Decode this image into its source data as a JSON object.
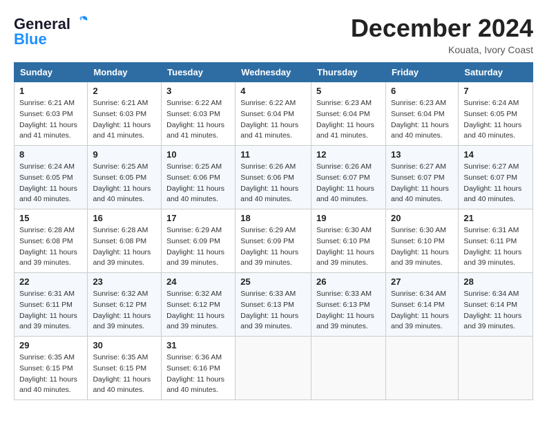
{
  "header": {
    "logo_line1": "General",
    "logo_line2": "Blue",
    "month_title": "December 2024",
    "location": "Kouata, Ivory Coast"
  },
  "days_of_week": [
    "Sunday",
    "Monday",
    "Tuesday",
    "Wednesday",
    "Thursday",
    "Friday",
    "Saturday"
  ],
  "weeks": [
    [
      {
        "day": "1",
        "sunrise": "6:21 AM",
        "sunset": "6:03 PM",
        "daylight": "11 hours and 41 minutes."
      },
      {
        "day": "2",
        "sunrise": "6:21 AM",
        "sunset": "6:03 PM",
        "daylight": "11 hours and 41 minutes."
      },
      {
        "day": "3",
        "sunrise": "6:22 AM",
        "sunset": "6:03 PM",
        "daylight": "11 hours and 41 minutes."
      },
      {
        "day": "4",
        "sunrise": "6:22 AM",
        "sunset": "6:04 PM",
        "daylight": "11 hours and 41 minutes."
      },
      {
        "day": "5",
        "sunrise": "6:23 AM",
        "sunset": "6:04 PM",
        "daylight": "11 hours and 41 minutes."
      },
      {
        "day": "6",
        "sunrise": "6:23 AM",
        "sunset": "6:04 PM",
        "daylight": "11 hours and 40 minutes."
      },
      {
        "day": "7",
        "sunrise": "6:24 AM",
        "sunset": "6:05 PM",
        "daylight": "11 hours and 40 minutes."
      }
    ],
    [
      {
        "day": "8",
        "sunrise": "6:24 AM",
        "sunset": "6:05 PM",
        "daylight": "11 hours and 40 minutes."
      },
      {
        "day": "9",
        "sunrise": "6:25 AM",
        "sunset": "6:05 PM",
        "daylight": "11 hours and 40 minutes."
      },
      {
        "day": "10",
        "sunrise": "6:25 AM",
        "sunset": "6:06 PM",
        "daylight": "11 hours and 40 minutes."
      },
      {
        "day": "11",
        "sunrise": "6:26 AM",
        "sunset": "6:06 PM",
        "daylight": "11 hours and 40 minutes."
      },
      {
        "day": "12",
        "sunrise": "6:26 AM",
        "sunset": "6:07 PM",
        "daylight": "11 hours and 40 minutes."
      },
      {
        "day": "13",
        "sunrise": "6:27 AM",
        "sunset": "6:07 PM",
        "daylight": "11 hours and 40 minutes."
      },
      {
        "day": "14",
        "sunrise": "6:27 AM",
        "sunset": "6:07 PM",
        "daylight": "11 hours and 40 minutes."
      }
    ],
    [
      {
        "day": "15",
        "sunrise": "6:28 AM",
        "sunset": "6:08 PM",
        "daylight": "11 hours and 39 minutes."
      },
      {
        "day": "16",
        "sunrise": "6:28 AM",
        "sunset": "6:08 PM",
        "daylight": "11 hours and 39 minutes."
      },
      {
        "day": "17",
        "sunrise": "6:29 AM",
        "sunset": "6:09 PM",
        "daylight": "11 hours and 39 minutes."
      },
      {
        "day": "18",
        "sunrise": "6:29 AM",
        "sunset": "6:09 PM",
        "daylight": "11 hours and 39 minutes."
      },
      {
        "day": "19",
        "sunrise": "6:30 AM",
        "sunset": "6:10 PM",
        "daylight": "11 hours and 39 minutes."
      },
      {
        "day": "20",
        "sunrise": "6:30 AM",
        "sunset": "6:10 PM",
        "daylight": "11 hours and 39 minutes."
      },
      {
        "day": "21",
        "sunrise": "6:31 AM",
        "sunset": "6:11 PM",
        "daylight": "11 hours and 39 minutes."
      }
    ],
    [
      {
        "day": "22",
        "sunrise": "6:31 AM",
        "sunset": "6:11 PM",
        "daylight": "11 hours and 39 minutes."
      },
      {
        "day": "23",
        "sunrise": "6:32 AM",
        "sunset": "6:12 PM",
        "daylight": "11 hours and 39 minutes."
      },
      {
        "day": "24",
        "sunrise": "6:32 AM",
        "sunset": "6:12 PM",
        "daylight": "11 hours and 39 minutes."
      },
      {
        "day": "25",
        "sunrise": "6:33 AM",
        "sunset": "6:13 PM",
        "daylight": "11 hours and 39 minutes."
      },
      {
        "day": "26",
        "sunrise": "6:33 AM",
        "sunset": "6:13 PM",
        "daylight": "11 hours and 39 minutes."
      },
      {
        "day": "27",
        "sunrise": "6:34 AM",
        "sunset": "6:14 PM",
        "daylight": "11 hours and 39 minutes."
      },
      {
        "day": "28",
        "sunrise": "6:34 AM",
        "sunset": "6:14 PM",
        "daylight": "11 hours and 39 minutes."
      }
    ],
    [
      {
        "day": "29",
        "sunrise": "6:35 AM",
        "sunset": "6:15 PM",
        "daylight": "11 hours and 40 minutes."
      },
      {
        "day": "30",
        "sunrise": "6:35 AM",
        "sunset": "6:15 PM",
        "daylight": "11 hours and 40 minutes."
      },
      {
        "day": "31",
        "sunrise": "6:36 AM",
        "sunset": "6:16 PM",
        "daylight": "11 hours and 40 minutes."
      },
      null,
      null,
      null,
      null
    ]
  ]
}
